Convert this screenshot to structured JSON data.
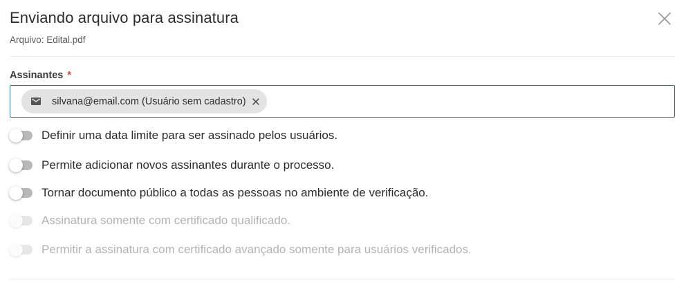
{
  "dialog": {
    "title": "Enviando arquivo para assinatura",
    "subtitle": "Arquivo: Edital.pdf",
    "close_icon": "close-icon"
  },
  "signers": {
    "label": "Assinantes",
    "required_mark": "*",
    "chips": [
      {
        "icon": "mail-icon",
        "text": "silvana@email.com (Usuário sem cadastro)",
        "remove_icon": "close-icon"
      }
    ]
  },
  "options": [
    {
      "label": "Definir uma data limite para ser assinado pelos usuários.",
      "enabled": true,
      "checked": false
    },
    {
      "label": "Permite adicionar novos assinantes durante o processo.",
      "enabled": true,
      "checked": false
    },
    {
      "label": "Tornar documento público a todas as pessoas no ambiente de verificação.",
      "enabled": true,
      "checked": false
    },
    {
      "label": "Assinatura somente com certificado qualificado.",
      "enabled": false,
      "checked": false
    },
    {
      "label": "Permitir a assinatura com certificado avançado somente para usuários verificados.",
      "enabled": false,
      "checked": false
    }
  ],
  "colors": {
    "input_border": "#2f6f8a",
    "required": "#d23b3b",
    "chip_bg": "#e3e3e3",
    "toggle_off": "#b9b9b9",
    "disabled_text": "#b3b3b3"
  }
}
